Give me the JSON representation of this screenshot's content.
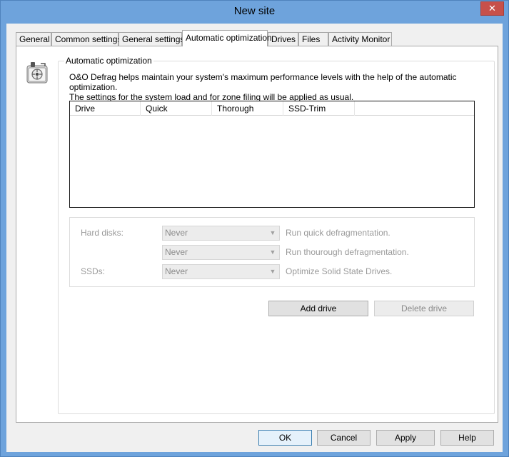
{
  "window": {
    "title": "New site",
    "close_glyph": "✕"
  },
  "tabs": [
    {
      "label": "General",
      "active": false
    },
    {
      "label": "Common settings",
      "active": false
    },
    {
      "label": "General settings",
      "active": false
    },
    {
      "label": "Automatic optimization",
      "active": true
    },
    {
      "label": "Drives",
      "active": false
    },
    {
      "label": "Files",
      "active": false
    },
    {
      "label": "Activity Monitor",
      "active": false
    }
  ],
  "group": {
    "legend": "Automatic optimization",
    "description_line1": "O&O Defrag helps maintain your system's maximum performance levels with the help of the automatic optimization.",
    "description_line2": "The settings for the system load and for zone filing will be applied as usual."
  },
  "drive_list": {
    "columns": [
      "Drive",
      "Quick",
      "Thorough",
      "SSD-Trim"
    ],
    "rows": []
  },
  "settings": {
    "hard_disks_label": "Hard disks:",
    "ssds_label": "SSDs:",
    "quick": {
      "value": "Never",
      "hint": "Run quick defragmentation."
    },
    "thorough": {
      "value": "Never",
      "hint": "Run thourough defragmentation."
    },
    "ssd": {
      "value": "Never",
      "hint": "Optimize Solid State Drives."
    }
  },
  "buttons": {
    "add_drive": "Add drive",
    "delete_drive": "Delete drive",
    "ok": "OK",
    "cancel": "Cancel",
    "apply": "Apply",
    "help": "Help"
  }
}
